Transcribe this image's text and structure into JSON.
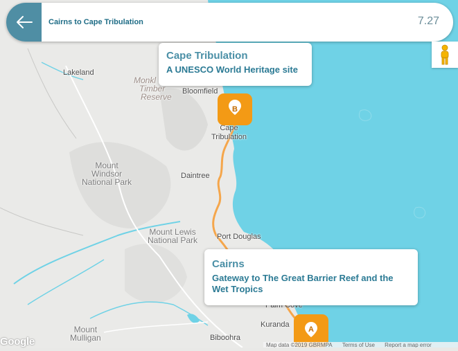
{
  "header": {
    "back_icon": "arrow-left-icon",
    "route_title": "Cairns to Cape Tribulation",
    "distance": "7.27"
  },
  "colors": {
    "accent": "#4f8ea4",
    "water": "#6fd2e6",
    "route": "#f5a64b",
    "marker": "#f39a15"
  },
  "map": {
    "places": {
      "lakeland": "Lakeland",
      "bloomfield": "Bloomfield",
      "monklands_timber_reserve": [
        "Monkl",
        "Timber",
        "Reserve"
      ],
      "cape_tribulation": [
        "Cape",
        "Tribulation"
      ],
      "mount_windsor_np": [
        "Mount",
        "Windsor",
        "National Park"
      ],
      "daintree": "Daintree",
      "mount_lewis_np": [
        "Mount Lewis",
        "National Park"
      ],
      "port_douglas": "Port Douglas",
      "palm_cove": "Palm Cove",
      "kuranda": "Kuranda",
      "mount_mulligan": [
        "Mount",
        "Mulligan"
      ],
      "biboohra": "Biboohra"
    },
    "markers": {
      "b_label": "B",
      "a_label": "A"
    },
    "google_logo": "Google",
    "attribution": {
      "map_data": "Map data ©2019 GBRMPA",
      "terms": "Terms of Use",
      "report": "Report a map error"
    }
  },
  "cards": {
    "destination": {
      "title": "Cape Tribulation",
      "subtitle": "A UNESCO World Heritage site"
    },
    "origin": {
      "title": "Cairns",
      "subtitle": "Gateway to The Great Barrier Reef and the Wet Tropics"
    }
  },
  "controls": {
    "street_view_icon": "pegman-icon"
  }
}
